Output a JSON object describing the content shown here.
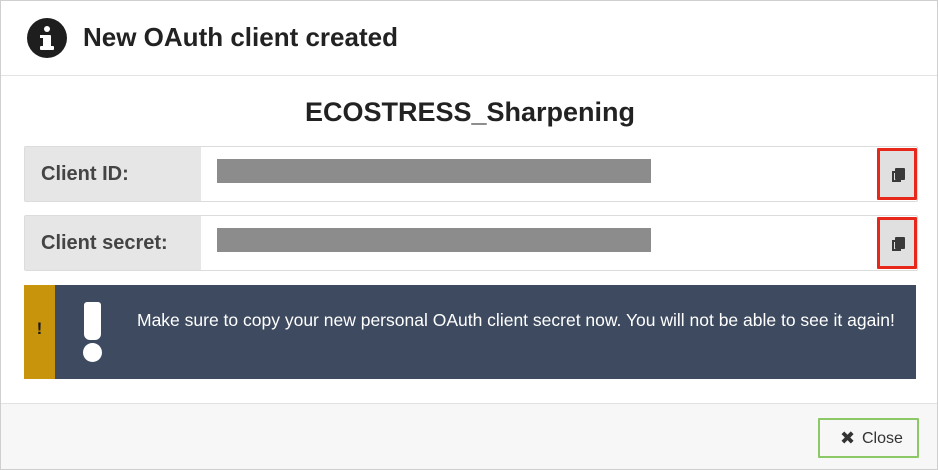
{
  "dialog": {
    "title": "New OAuth client created",
    "app_name": "ECOSTRESS_Sharpening"
  },
  "fields": [
    {
      "label": "Client ID:",
      "value": "",
      "copy_icon": "copy-icon"
    },
    {
      "label": "Client secret:",
      "value": "",
      "copy_icon": "copy-icon"
    }
  ],
  "alert": {
    "stripe_mark": "!",
    "icon": "exclamation-icon",
    "message": "Make sure to copy your new personal OAuth client secret now. You will not be able to see it again!"
  },
  "footer": {
    "close_icon": "✖",
    "close_label": "Close"
  },
  "colors": {
    "highlight_outline": "#e8271b",
    "alert_background": "#3d4a5f",
    "alert_stripe": "#c8940b",
    "close_button_border": "#8cc866"
  }
}
